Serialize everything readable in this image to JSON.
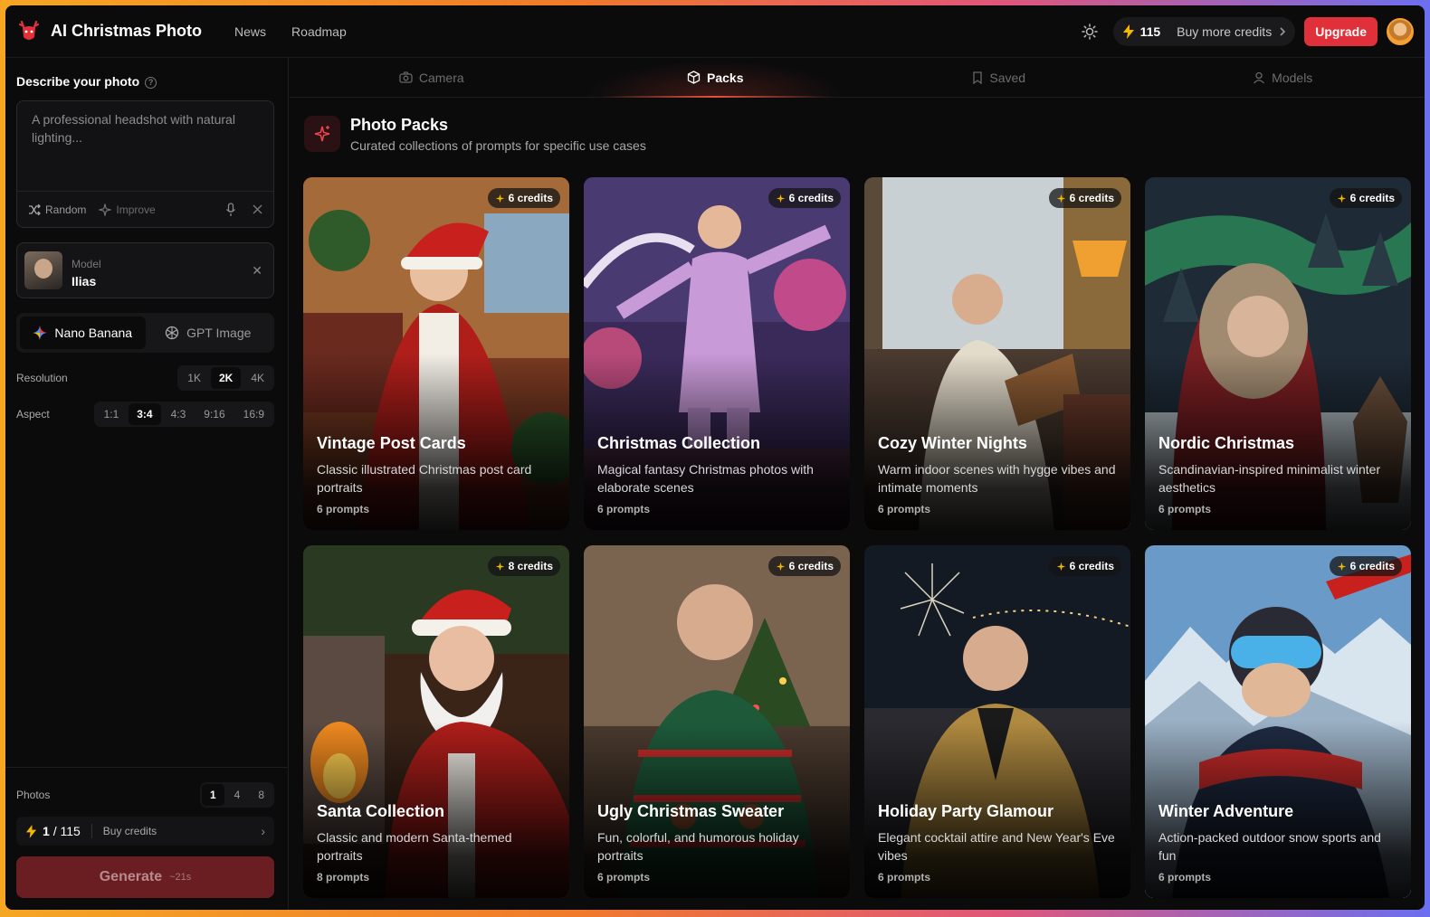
{
  "header": {
    "brand": "AI Christmas Photo",
    "nav": [
      "News",
      "Roadmap"
    ],
    "credits": "115",
    "buy_more": "Buy more credits",
    "upgrade": "Upgrade"
  },
  "sidebar": {
    "describe_title": "Describe your photo",
    "prompt_placeholder": "A professional headshot with natural lighting...",
    "random": "Random",
    "improve": "Improve",
    "model_label": "Model",
    "model_name": "Ilias",
    "engines": [
      "Nano Banana",
      "GPT Image"
    ],
    "active_engine": "Nano Banana",
    "resolution_label": "Resolution",
    "resolutions": [
      "1K",
      "2K",
      "4K"
    ],
    "active_resolution": "2K",
    "aspect_label": "Aspect",
    "aspects": [
      "1:1",
      "3:4",
      "4:3",
      "9:16",
      "16:9"
    ],
    "active_aspect": "3:4",
    "photos_label": "Photos",
    "photo_counts": [
      "1",
      "4",
      "8"
    ],
    "active_photo_count": "1",
    "credit_usage": "1",
    "credit_total": "/ 115",
    "buy_credits": "Buy credits",
    "generate": "Generate",
    "generate_eta": "~21s"
  },
  "tabs": [
    "Camera",
    "Packs",
    "Saved",
    "Models"
  ],
  "active_tab": "Packs",
  "packs": {
    "title": "Photo Packs",
    "subtitle": "Curated collections of prompts for specific use cases",
    "items": [
      {
        "title": "Vintage Post Cards",
        "desc": "Classic illustrated Christmas post card portraits",
        "count": "6 prompts",
        "credits": "6 credits"
      },
      {
        "title": "Christmas Collection",
        "desc": "Magical fantasy Christmas photos with elaborate scenes",
        "count": "6 prompts",
        "credits": "6 credits"
      },
      {
        "title": "Cozy Winter Nights",
        "desc": "Warm indoor scenes with hygge vibes and intimate moments",
        "count": "6 prompts",
        "credits": "6 credits"
      },
      {
        "title": "Nordic Christmas",
        "desc": "Scandinavian-inspired minimalist winter aesthetics",
        "count": "6 prompts",
        "credits": "6 credits"
      },
      {
        "title": "Santa Collection",
        "desc": "Classic and modern Santa-themed portraits",
        "count": "8 prompts",
        "credits": "8 credits"
      },
      {
        "title": "Ugly Christmas Sweater",
        "desc": "Fun, colorful, and humorous holiday portraits",
        "count": "6 prompts",
        "credits": "6 credits"
      },
      {
        "title": "Holiday Party Glamour",
        "desc": "Elegant cocktail attire and New Year's Eve vibes",
        "count": "6 prompts",
        "credits": "6 credits"
      },
      {
        "title": "Winter Adventure",
        "desc": "Action-packed outdoor snow sports and fun",
        "count": "6 prompts",
        "credits": "6 credits"
      }
    ]
  },
  "colors": {
    "accent": "#e0313a",
    "credit_yellow": "#f5b800",
    "background": "#0b0b0c"
  }
}
